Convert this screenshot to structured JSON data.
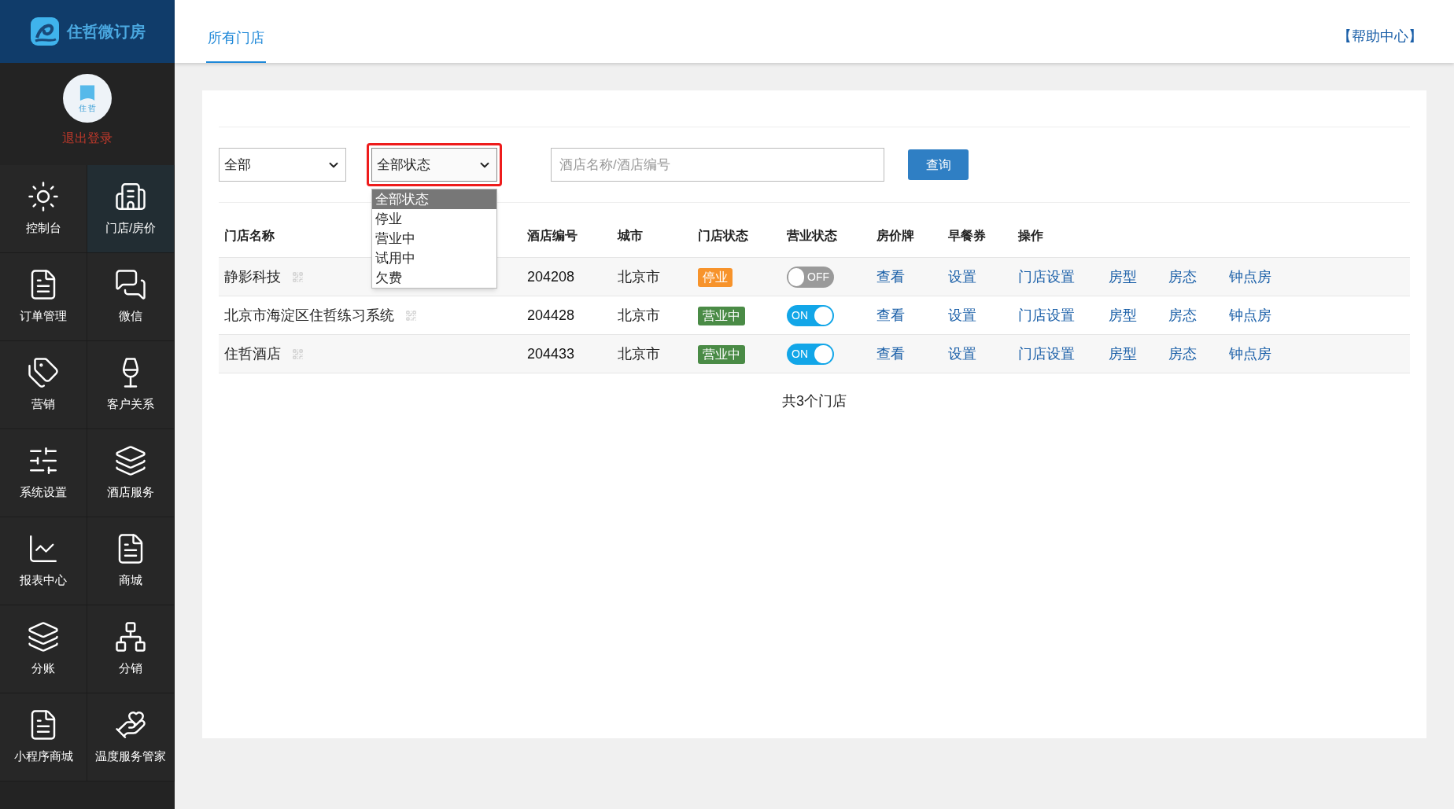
{
  "brand": {
    "name": "住哲微订房"
  },
  "user": {
    "avatar_text": "住 哲",
    "logout": "退出登录"
  },
  "sidebar": {
    "items": [
      {
        "label": "控制台",
        "selected": false
      },
      {
        "label": "门店/房价",
        "selected": true
      },
      {
        "label": "订单管理",
        "selected": false
      },
      {
        "label": "微信",
        "selected": false
      },
      {
        "label": "营销",
        "selected": false
      },
      {
        "label": "客户关系",
        "selected": false
      },
      {
        "label": "系统设置",
        "selected": false
      },
      {
        "label": "酒店服务",
        "selected": false
      },
      {
        "label": "报表中心",
        "selected": false
      },
      {
        "label": "商城",
        "selected": false
      },
      {
        "label": "分账",
        "selected": false
      },
      {
        "label": "分销",
        "selected": false
      },
      {
        "label": "小程序商城",
        "selected": false
      },
      {
        "label": "温度服务管家",
        "selected": false
      }
    ]
  },
  "tabs": [
    {
      "label": "所有门店",
      "selected": true
    }
  ],
  "help_link": "【帮助中心】",
  "filters": {
    "group_select": {
      "value": "全部"
    },
    "status_select": {
      "value": "全部状态",
      "highlighted": true,
      "expanded": true,
      "options": [
        {
          "label": "全部状态",
          "selected": true
        },
        {
          "label": "停业",
          "selected": false
        },
        {
          "label": "营业中",
          "selected": false
        },
        {
          "label": "试用中",
          "selected": false
        },
        {
          "label": "欠费",
          "selected": false
        }
      ]
    },
    "search": {
      "placeholder": "酒店名称/酒店编号"
    },
    "query_button": "查询"
  },
  "table": {
    "columns": [
      "门店名称",
      "酒店编号",
      "城市",
      "门店状态",
      "营业状态",
      "房价牌",
      "早餐券",
      "操作"
    ],
    "rows": [
      {
        "name": "静影科技",
        "code": "204208",
        "city": "北京市",
        "status": {
          "label": "停业",
          "kind": "closed"
        },
        "business": {
          "on": false,
          "label": "OFF"
        },
        "price_board": "查看",
        "breakfast": "设置",
        "actions": [
          "门店设置",
          "房型",
          "房态",
          "钟点房"
        ]
      },
      {
        "name": "北京市海淀区住哲练习系统",
        "code": "204428",
        "city": "北京市",
        "status": {
          "label": "营业中",
          "kind": "open"
        },
        "business": {
          "on": true,
          "label": "ON"
        },
        "price_board": "查看",
        "breakfast": "设置",
        "actions": [
          "门店设置",
          "房型",
          "房态",
          "钟点房"
        ]
      },
      {
        "name": "住哲酒店",
        "code": "204433",
        "city": "北京市",
        "status": {
          "label": "营业中",
          "kind": "open"
        },
        "business": {
          "on": true,
          "label": "ON"
        },
        "price_board": "查看",
        "breakfast": "设置",
        "actions": [
          "门店设置",
          "房型",
          "房态",
          "钟点房"
        ]
      }
    ]
  },
  "total": "共3个门店"
}
